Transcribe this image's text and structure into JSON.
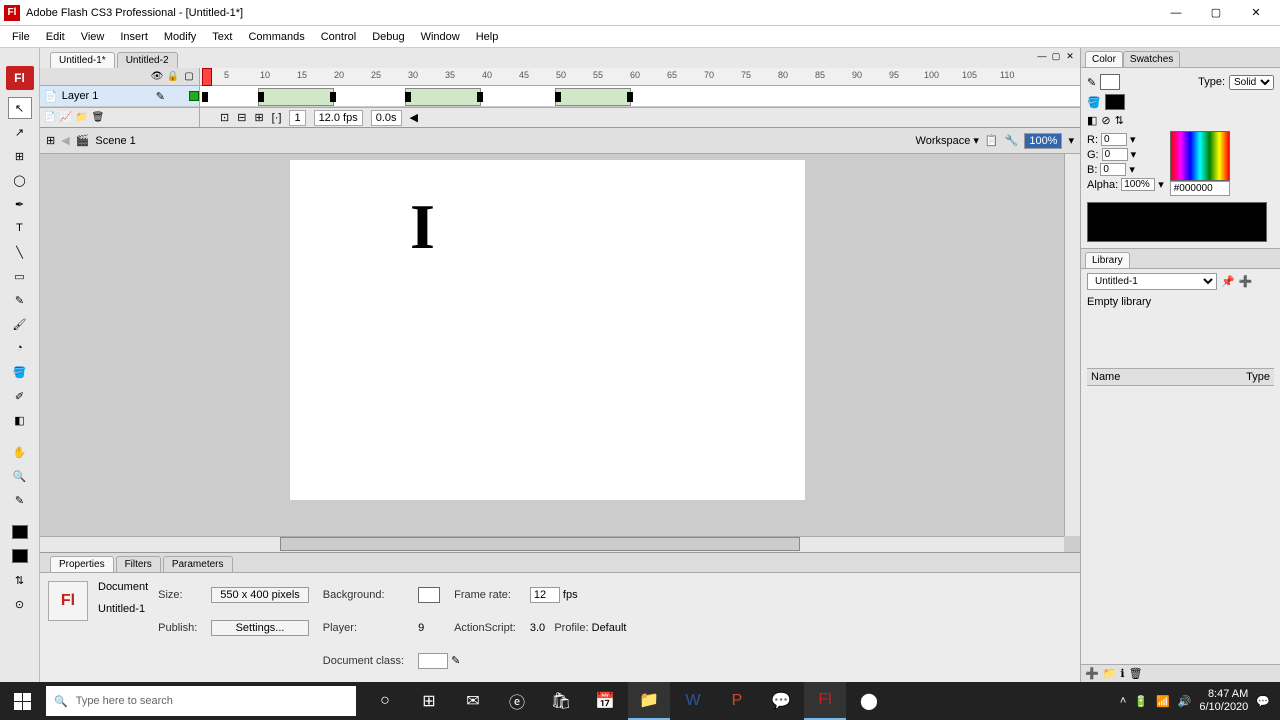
{
  "window": {
    "title": "Adobe Flash CS3 Professional - [Untitled-1*]"
  },
  "menu": [
    "File",
    "Edit",
    "View",
    "Insert",
    "Modify",
    "Text",
    "Commands",
    "Control",
    "Debug",
    "Window",
    "Help"
  ],
  "doc_tabs": [
    "Untitled-1*",
    "Untitled-2"
  ],
  "layer": {
    "name": "Layer 1"
  },
  "timeline": {
    "ticks": [
      5,
      10,
      15,
      20,
      25,
      30,
      35,
      40,
      45,
      50,
      55,
      60,
      65,
      70,
      75,
      80,
      85,
      90,
      95,
      100,
      105,
      110
    ],
    "current_frame": "1",
    "fps": "12.0 fps",
    "time": "0.0s"
  },
  "scene": {
    "name": "Scene 1",
    "workspace": "Workspace ▾",
    "zoom": "100%"
  },
  "stage": {
    "text": "I"
  },
  "properties": {
    "tabs": [
      "Properties",
      "Filters",
      "Parameters"
    ],
    "type": "Document",
    "doc_name": "Untitled-1",
    "size_label": "Size:",
    "size_value": "550 x 400 pixels",
    "background_label": "Background:",
    "framerate_label": "Frame rate:",
    "framerate_value": "12",
    "fps_unit": "fps",
    "publish_label": "Publish:",
    "publish_btn": "Settings...",
    "player_label": "Player:",
    "player_value": "9",
    "as_label": "ActionScript:",
    "as_value": "3.0",
    "profile_label": "Profile:",
    "profile_value": "Default",
    "docclass_label": "Document class:"
  },
  "color_panel": {
    "tabs": [
      "Color",
      "Swatches"
    ],
    "type_label": "Type:",
    "type_value": "Solid",
    "r": "0",
    "g": "0",
    "b": "0",
    "alpha_label": "Alpha:",
    "alpha": "100%",
    "hex": "#000000"
  },
  "library": {
    "tab": "Library",
    "selected": "Untitled-1",
    "empty": "Empty library",
    "col_name": "Name",
    "col_type": "Type"
  },
  "taskbar": {
    "search_placeholder": "Type here to search",
    "time": "8:47 AM",
    "date": "6/10/2020"
  }
}
